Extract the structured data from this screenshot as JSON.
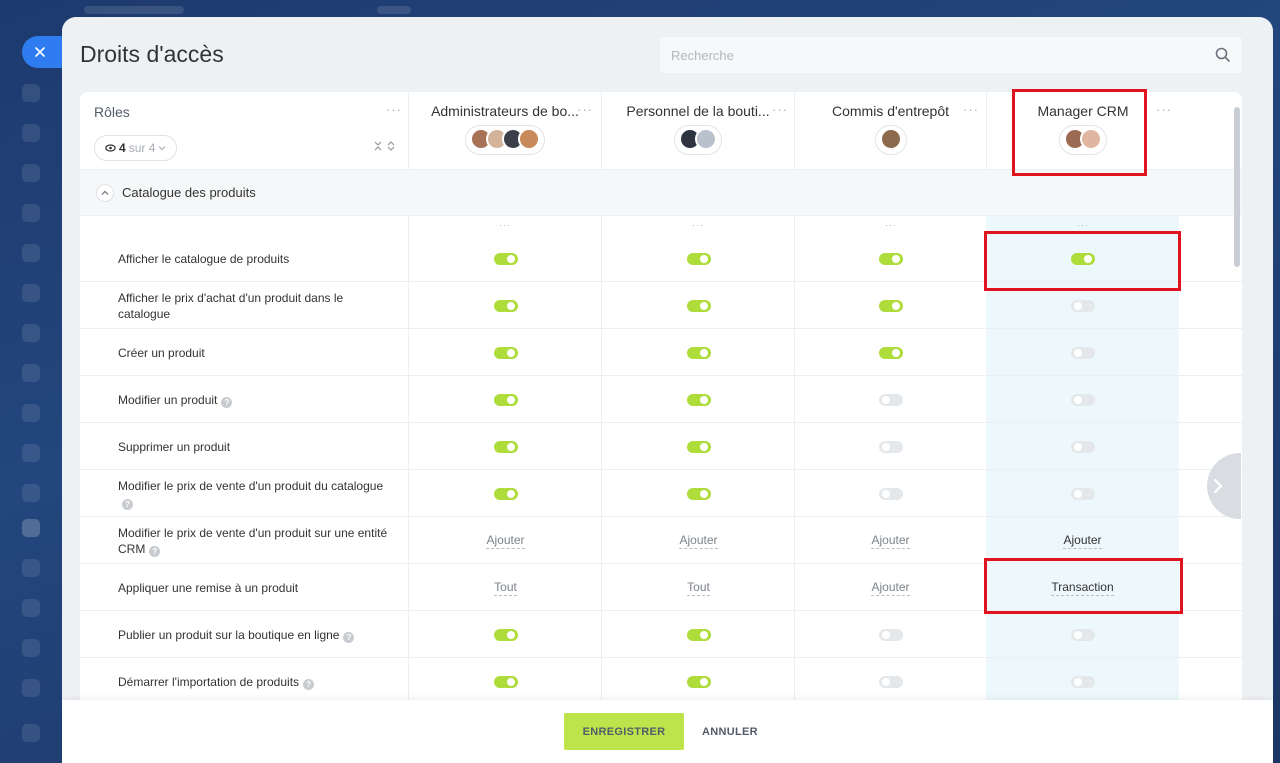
{
  "window": {
    "close_icon": "close-icon"
  },
  "page": {
    "title": "Droits d'accès"
  },
  "search": {
    "placeholder": "Recherche",
    "icon": "search-icon"
  },
  "roles_header": {
    "label": "Rôles",
    "menu": "···",
    "counter_count": "4",
    "counter_text": "sur 4"
  },
  "roles": [
    {
      "name": "Administrateurs de bo...",
      "menu": "···"
    },
    {
      "name": "Personnel de la bouti...",
      "menu": "···"
    },
    {
      "name": "Commis d'entrepôt",
      "menu": "···"
    },
    {
      "name": "Manager CRM",
      "menu": "···"
    }
  ],
  "section": {
    "label": "Catalogue des produits",
    "dots": "···"
  },
  "permissions": [
    {
      "label": "Afficher le catalogue de produits",
      "help": false,
      "values": [
        "on",
        "on",
        "on",
        "on"
      ]
    },
    {
      "label": "Afficher le prix d'achat d'un produit dans le catalogue",
      "help": false,
      "values": [
        "on",
        "on",
        "on",
        "off"
      ]
    },
    {
      "label": "Créer un produit",
      "help": false,
      "values": [
        "on",
        "on",
        "on",
        "off"
      ]
    },
    {
      "label": "Modifier un produit",
      "help": true,
      "values": [
        "on",
        "on",
        "off",
        "off"
      ]
    },
    {
      "label": "Supprimer un produit",
      "help": false,
      "values": [
        "on",
        "on",
        "off",
        "off"
      ]
    },
    {
      "label": "Modifier le prix de vente d'un produit du catalogue",
      "help": true,
      "values": [
        "on",
        "on",
        "off",
        "off"
      ]
    },
    {
      "label": "Modifier le prix de vente d'un produit sur une entité CRM",
      "help": true,
      "values": [
        "Ajouter",
        "Ajouter",
        "Ajouter",
        "Ajouter"
      ]
    },
    {
      "label": "Appliquer une remise à un produit",
      "help": false,
      "values": [
        "Tout",
        "Tout",
        "Ajouter",
        "Transaction"
      ]
    },
    {
      "label": "Publier un produit sur la boutique en ligne",
      "help": true,
      "values": [
        "on",
        "on",
        "off",
        "off"
      ]
    },
    {
      "label": "Démarrer l'importation de produits",
      "help": true,
      "values": [
        "on",
        "on",
        "off",
        "off"
      ]
    }
  ],
  "footer": {
    "save_label": "ENREGISTRER",
    "cancel_label": "ANNULER"
  },
  "colors": {
    "toggle_on": "#aedc3a",
    "highlight": "#e0141e",
    "save_button": "#bde44b"
  }
}
